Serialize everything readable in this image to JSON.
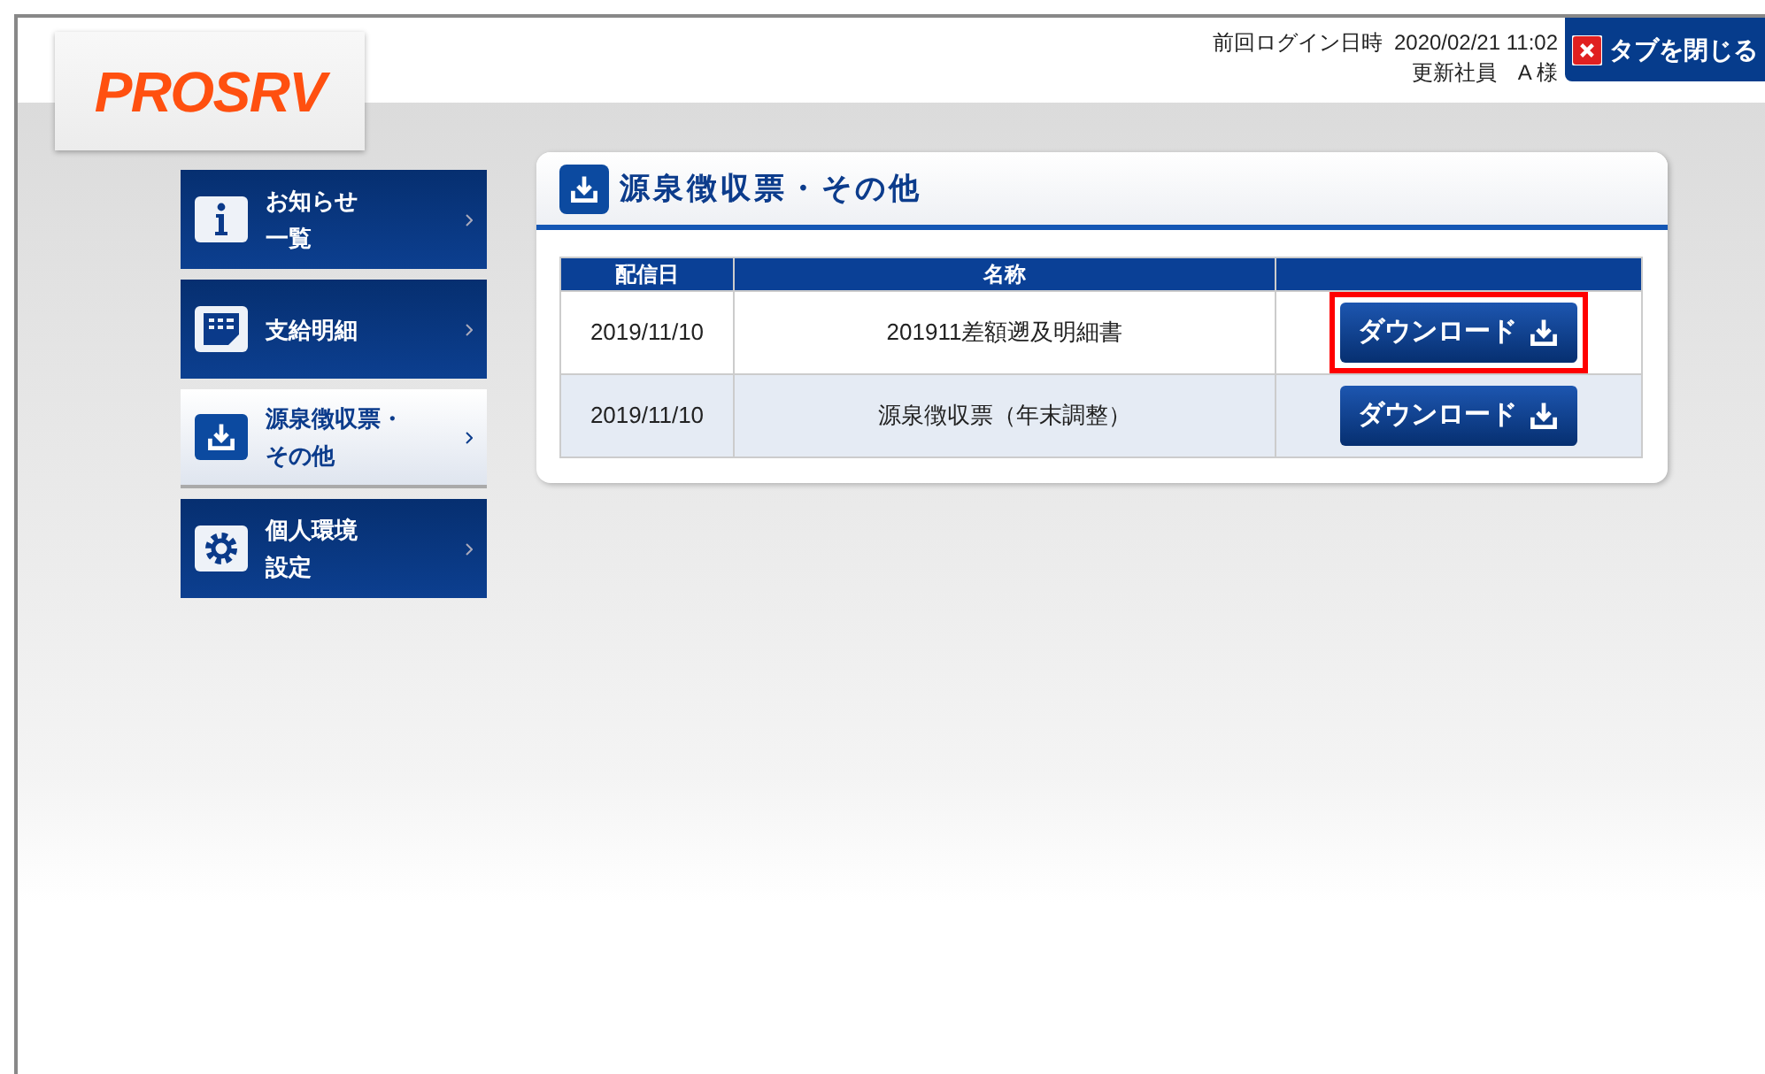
{
  "logo": "PROSRV",
  "header": {
    "last_login": "前回ログイン日時  2020/02/21 11:02",
    "user": "更新社員　A 様",
    "close_tab": "タブを閉じる"
  },
  "sidebar": {
    "items": [
      {
        "kind": "info",
        "lines": [
          "お知らせ",
          "一覧"
        ],
        "selected": false
      },
      {
        "kind": "table",
        "lines": [
          "支給明細"
        ],
        "selected": false
      },
      {
        "kind": "download",
        "lines": [
          "源泉徴収票・",
          "その他"
        ],
        "selected": true
      },
      {
        "kind": "gear",
        "lines": [
          "個人環境",
          "設定"
        ],
        "selected": false
      }
    ]
  },
  "panel": {
    "title": "源泉徴収票・その他",
    "table": {
      "columns": [
        "配信日",
        "名称"
      ],
      "rows": [
        {
          "date": "2019/11/10",
          "name": "201911差額遡及明細書",
          "button": "ダウンロード",
          "highlighted": true
        },
        {
          "date": "2019/11/10",
          "name": "源泉徴収票（年末調整）",
          "button": "ダウンロード",
          "highlighted": false
        }
      ]
    }
  }
}
